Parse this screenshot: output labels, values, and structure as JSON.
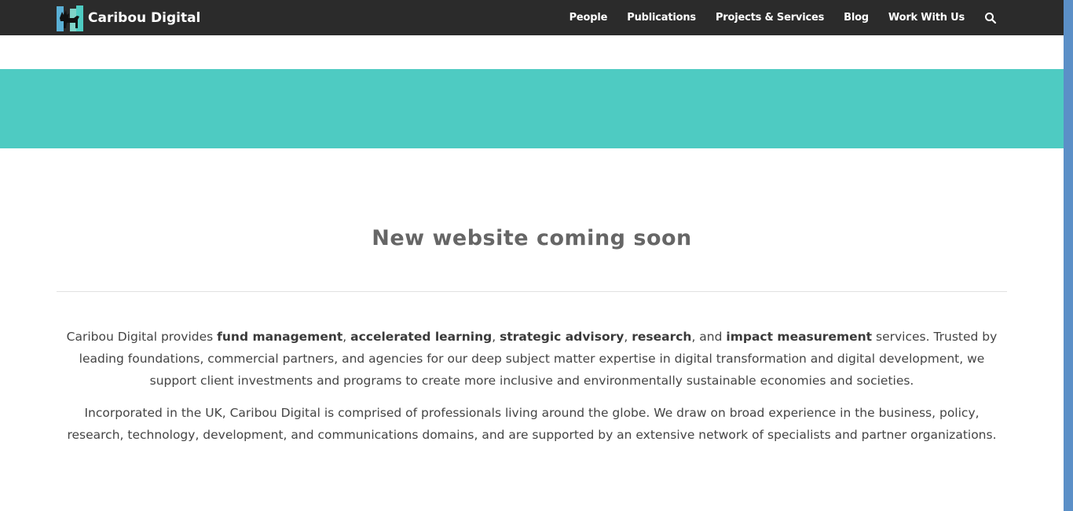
{
  "header": {
    "logo_text": "Caribou Digital",
    "nav": [
      {
        "label": "People"
      },
      {
        "label": "Publications"
      },
      {
        "label": "Projects & Services"
      },
      {
        "label": "Blog"
      },
      {
        "label": "Work With Us"
      }
    ],
    "search_icon": "search-icon"
  },
  "main": {
    "title": "New website coming soon",
    "p1": {
      "t1": "Caribou Digital provides ",
      "b1": "fund management",
      "t2": ", ",
      "b2": "accelerated learning",
      "t3": ", ",
      "b3": "strategic advisory",
      "t4": ", ",
      "b4": "research",
      "t5": ", and ",
      "b5": "impact measurement",
      "t6": " services. Trusted by leading foundations, commercial partners, and agencies for our deep subject matter expertise in digital transformation and digital development, we support client investments and programs to create more inclusive and environmentally sustainable economies and societies."
    },
    "p2": "Incorporated in the UK, Caribou Digital is comprised of professionals living around the globe. We draw on broad experience in the business, policy, research, technology, development, and communications domains, and are supported by an extensive network of specialists and partner organizations."
  },
  "colors": {
    "header_bg": "#2b2b2b",
    "band": "#4ecbc2",
    "heading": "#666666",
    "text": "#444444",
    "scrollbar": "#5b8fc7"
  }
}
